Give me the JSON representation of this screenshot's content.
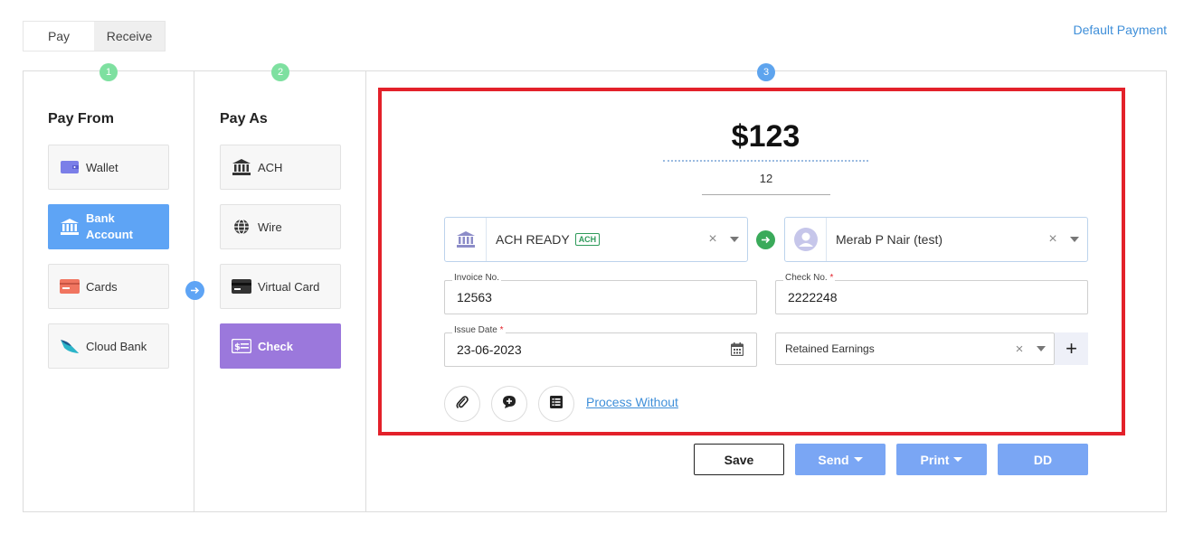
{
  "tabs": {
    "pay": "Pay",
    "receive": "Receive"
  },
  "default_payment_link": "Default Payment",
  "steps": [
    "1",
    "2",
    "3"
  ],
  "pay_from": {
    "title": "Pay From",
    "options": [
      {
        "label": "Wallet",
        "icon": "wallet-icon"
      },
      {
        "label": "Bank\nAccount",
        "icon": "bank-icon",
        "selected": true
      },
      {
        "label": "Cards",
        "icon": "card-icon"
      },
      {
        "label": "Cloud Bank",
        "icon": "cloud-bank-icon"
      }
    ]
  },
  "pay_as": {
    "title": "Pay As",
    "options": [
      {
        "label": "ACH",
        "icon": "bank-icon"
      },
      {
        "label": "Wire",
        "icon": "globe-icon"
      },
      {
        "label": "Virtual Card",
        "icon": "credit-card-icon"
      },
      {
        "label": "Check",
        "icon": "check-icon",
        "selected": true
      }
    ]
  },
  "payment": {
    "amount": "$123",
    "memo": "12",
    "from_account": {
      "label": "ACH READY",
      "badge": "ACH"
    },
    "to_payee": {
      "label": "Merab P Nair (test)"
    },
    "invoice_no": {
      "label": "Invoice No.",
      "value": "12563"
    },
    "check_no": {
      "label": "Check No.",
      "value": "2222248",
      "required": "*"
    },
    "issue_date": {
      "label": "Issue Date",
      "value": "23-06-2023",
      "required": "*"
    },
    "account": {
      "value": "Retained Earnings"
    },
    "plus": "+",
    "process_without": "Process Without"
  },
  "actions": {
    "save": "Save",
    "send": "Send",
    "print": "Print",
    "dd": "DD"
  },
  "colors": {
    "accent_blue": "#5ea4f5",
    "accent_purple": "#9b78dc",
    "highlight_red": "#e3212a",
    "button_blue": "#7aa6f4",
    "success_green": "#3aaa5a"
  }
}
